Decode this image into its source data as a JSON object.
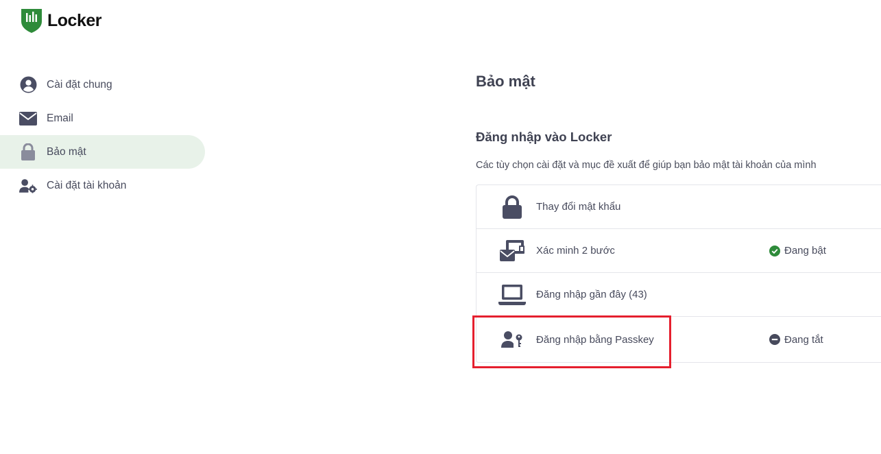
{
  "app": {
    "name": "Locker",
    "brand_color": "#2e8b3a"
  },
  "sidebar": {
    "items": [
      {
        "label": "Cài đặt chung",
        "icon": "user-circle-icon",
        "active": false
      },
      {
        "label": "Email",
        "icon": "envelope-icon",
        "active": false
      },
      {
        "label": "Bảo mật",
        "icon": "lock-icon",
        "active": true
      },
      {
        "label": "Cài đặt tài khoản",
        "icon": "user-cog-icon",
        "active": false
      }
    ],
    "active_bg": "#e8f2e9"
  },
  "main": {
    "title": "Bảo mật",
    "section": {
      "title": "Đăng nhập vào Locker",
      "description": "Các tùy chọn cài đặt và mục đề xuất để giúp bạn bảo mật tài khoản của mình",
      "rows": [
        {
          "label": "Thay đổi mật khẩu",
          "icon": "lock-icon",
          "status": ""
        },
        {
          "label": "Xác minh 2 bước",
          "icon": "two-step-verification-icon",
          "status": "Đang bật",
          "status_icon": "check-circle-icon",
          "status_color": "#2e8b3a"
        },
        {
          "label": "Đăng nhập gần đây (43)",
          "icon": "laptop-icon",
          "status": ""
        },
        {
          "label": "Đăng nhập bằng Passkey",
          "icon": "user-key-icon",
          "status": "Đang tắt",
          "status_icon": "minus-circle-icon",
          "status_color": "#474a5c"
        }
      ]
    }
  },
  "annotation": {
    "highlight_color": "#e51f2e"
  }
}
